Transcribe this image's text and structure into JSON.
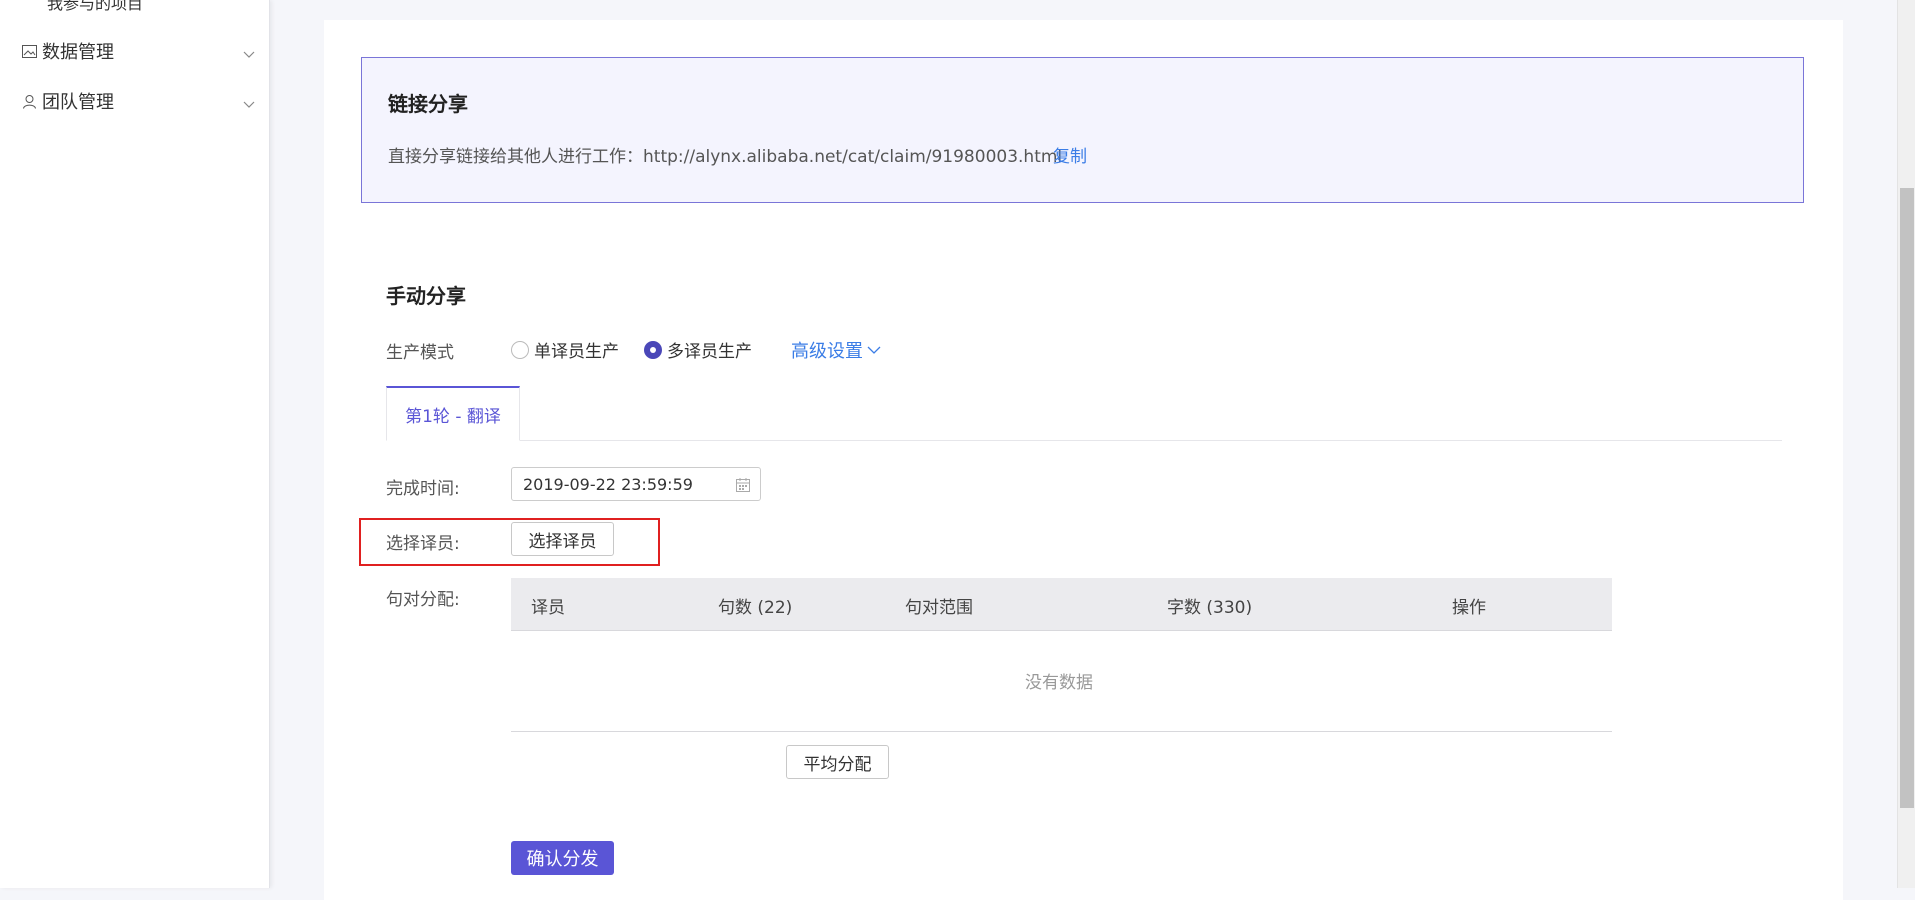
{
  "sidebar": {
    "sub_item": "我参与的项目",
    "items": [
      {
        "label": "数据管理",
        "icon": "image-icon"
      },
      {
        "label": "团队管理",
        "icon": "user-icon"
      }
    ]
  },
  "link_share": {
    "title": "链接分享",
    "text": "直接分享链接给其他人进行工作：http://alynx.alibaba.net/cat/claim/91980003.html",
    "copy_label": "复制"
  },
  "manual_share": {
    "title": "手动分享",
    "mode_label": "生产模式",
    "modes": [
      {
        "label": "单译员生产",
        "selected": false
      },
      {
        "label": "多译员生产",
        "selected": true
      }
    ],
    "advanced_label": "高级设置",
    "tabs": [
      {
        "label": "第1轮 - 翻译",
        "active": true
      }
    ],
    "deadline_label": "完成时间:",
    "deadline_value": "2019-09-22 23:59:59",
    "select_translator_label": "选择译员:",
    "select_translator_button": "选择译员",
    "allocation_label": "句对分配:",
    "table": {
      "columns": [
        "译员",
        "句数 (22)",
        "句对范围",
        "字数 (330)",
        "操作"
      ],
      "empty_text": "没有数据"
    },
    "average_button": "平均分配",
    "confirm_button": "确认分发"
  },
  "colors": {
    "accent": "#5a55d6",
    "link": "#3b7de6",
    "highlight": "#e02020",
    "share_box_bg": "#f4f4fe",
    "share_box_border": "#7a75d8"
  }
}
